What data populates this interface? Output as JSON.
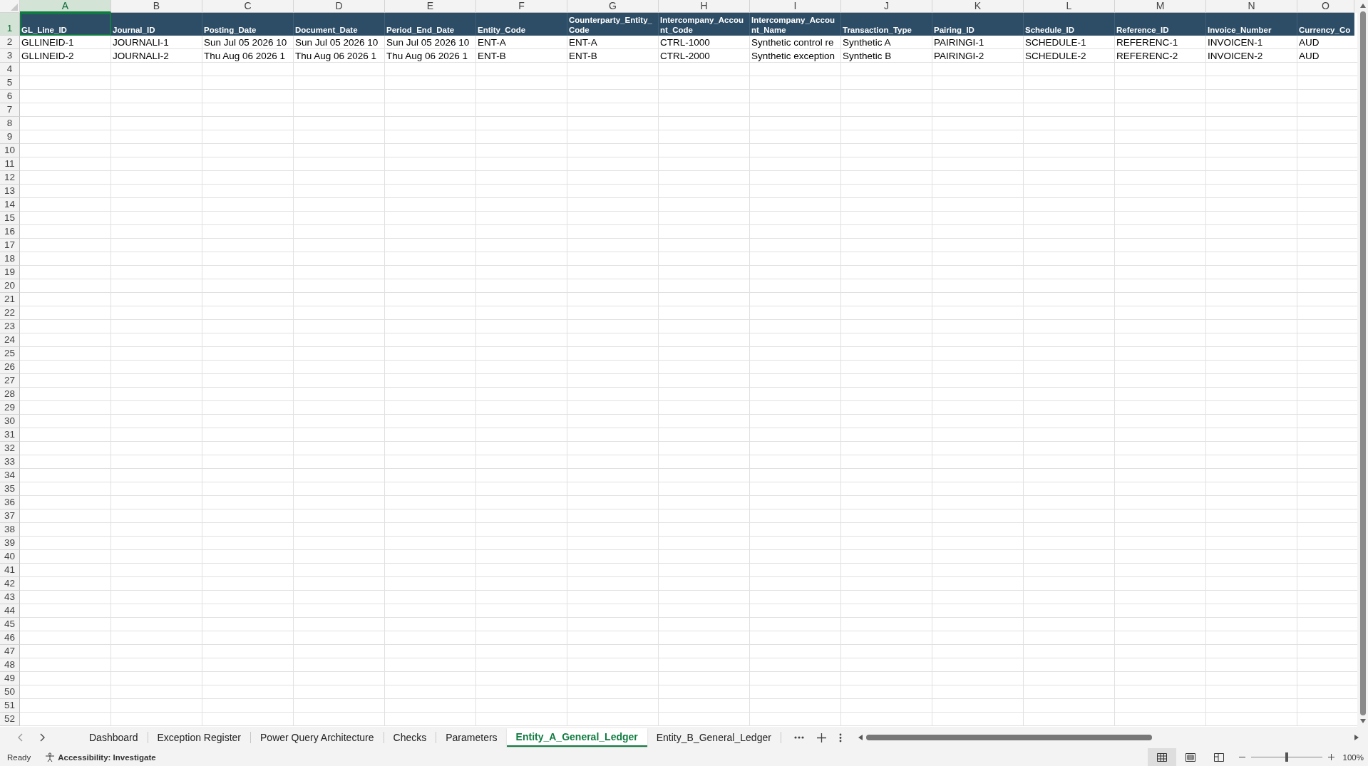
{
  "columns": [
    {
      "letter": "A",
      "header": "GL_Line_ID",
      "selected": true
    },
    {
      "letter": "B",
      "header": "Journal_ID",
      "selected": false
    },
    {
      "letter": "C",
      "header": "Posting_Date",
      "selected": false
    },
    {
      "letter": "D",
      "header": "Document_Date",
      "selected": false
    },
    {
      "letter": "E",
      "header": "Period_End_Date",
      "selected": false
    },
    {
      "letter": "F",
      "header": "Entity_Code",
      "selected": false
    },
    {
      "letter": "G",
      "header": "Counterparty_Entity_Code",
      "selected": false
    },
    {
      "letter": "H",
      "header": "Intercompany_Account_Code",
      "selected": false
    },
    {
      "letter": "I",
      "header": "Intercompany_Account_Name",
      "selected": false
    },
    {
      "letter": "J",
      "header": "Transaction_Type",
      "selected": false
    },
    {
      "letter": "K",
      "header": "Pairing_ID",
      "selected": false
    },
    {
      "letter": "L",
      "header": "Schedule_ID",
      "selected": false
    },
    {
      "letter": "M",
      "header": "Reference_ID",
      "selected": false
    },
    {
      "letter": "N",
      "header": "Invoice_Number",
      "selected": false
    },
    {
      "letter": "O",
      "header": "Currency_Co",
      "selected": false
    }
  ],
  "row_numbers": [
    "1",
    "2",
    "3",
    "4",
    "5",
    "6",
    "7",
    "8",
    "9",
    "10",
    "11",
    "12",
    "13",
    "14",
    "15",
    "16",
    "17",
    "18",
    "19",
    "20",
    "21",
    "22",
    "23",
    "24",
    "25",
    "26",
    "27",
    "28",
    "29",
    "30",
    "31",
    "32",
    "33",
    "34",
    "35",
    "36",
    "37",
    "38",
    "39",
    "40",
    "41",
    "42",
    "43",
    "44",
    "45",
    "46",
    "47",
    "48",
    "49",
    "50",
    "51",
    "52"
  ],
  "data_rows": [
    [
      "GLLINEID-1",
      "JOURNALI-1",
      "Sun Jul 05 2026 10",
      "Sun Jul 05 2026 10",
      "Sun Jul 05 2026 10",
      "ENT-A",
      "ENT-A",
      "CTRL-1000",
      "Synthetic control re",
      "Synthetic A",
      "PAIRINGI-1",
      "SCHEDULE-1",
      "REFERENC-1",
      "INVOICEN-1",
      "AUD"
    ],
    [
      "GLLINEID-2",
      "JOURNALI-2",
      "Thu Aug 06 2026 1",
      "Thu Aug 06 2026 1",
      "Thu Aug 06 2026 1",
      "ENT-B",
      "ENT-B",
      "CTRL-2000",
      "Synthetic exception",
      "Synthetic B",
      "PAIRINGI-2",
      "SCHEDULE-2",
      "REFERENC-2",
      "INVOICEN-2",
      "AUD"
    ]
  ],
  "sheet_tabs": [
    {
      "label": "Dashboard",
      "selected": false
    },
    {
      "label": "Exception Register",
      "selected": false
    },
    {
      "label": "Power Query Architecture",
      "selected": false
    },
    {
      "label": "Checks",
      "selected": false
    },
    {
      "label": "Parameters",
      "selected": false
    },
    {
      "label": "Entity_A_General_Ledger",
      "selected": true
    },
    {
      "label": "Entity_B_General_Ledger",
      "selected": false
    }
  ],
  "status_bar": {
    "mode": "Ready",
    "accessibility": "Accessibility: Investigate",
    "views": [
      {
        "kind": "normal",
        "selected": true
      },
      {
        "kind": "page_layout",
        "selected": false
      },
      {
        "kind": "page_break",
        "selected": false
      }
    ],
    "zoom": {
      "level": 0.5,
      "reading": "100%"
    }
  }
}
